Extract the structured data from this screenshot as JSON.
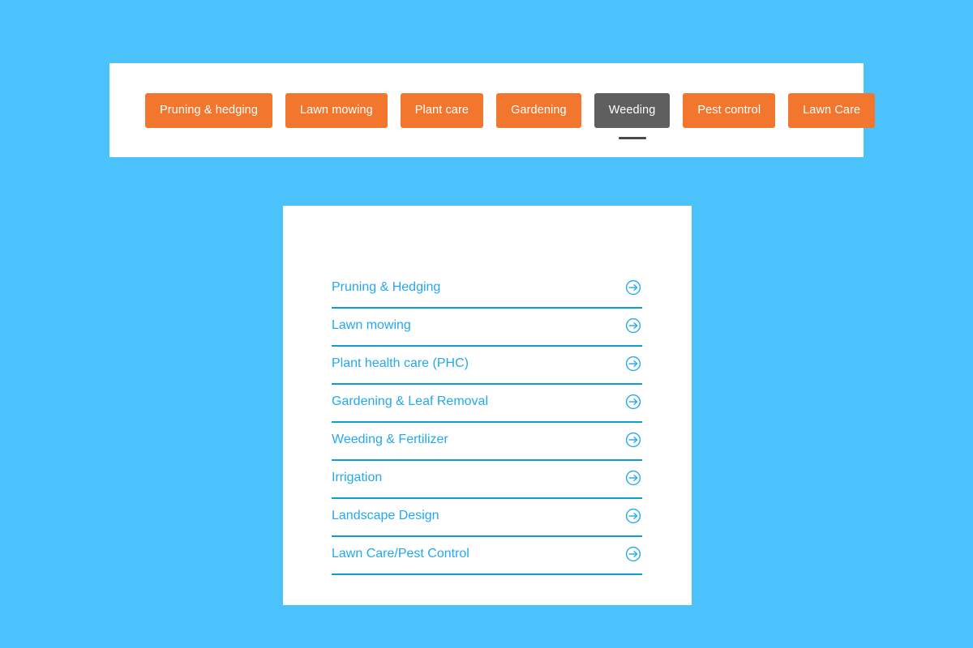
{
  "theme": {
    "page_background": "#4cc2fd",
    "card_background": "#ffffff",
    "tab_color": "#f2762e",
    "tab_active_color": "#5f5f5f",
    "tab_text_color": "#ffffff",
    "link_color": "#24a8f0",
    "divider_color": "#0d9ed9"
  },
  "tabbar": {
    "name": "service-category-tabs",
    "active_index": 4,
    "tabs": [
      {
        "label": "Pruning & hedging",
        "active": false
      },
      {
        "label": "Lawn mowing",
        "active": false
      },
      {
        "label": "Plant care",
        "active": false
      },
      {
        "label": "Gardening",
        "active": false
      },
      {
        "label": "Weeding",
        "active": true
      },
      {
        "label": "Pest control",
        "active": false
      },
      {
        "label": "Lawn Care",
        "active": false
      }
    ]
  },
  "services": {
    "name": "services-link-list",
    "arrow_icon": "arrow-circle-right-icon",
    "items": [
      {
        "label": "Pruning & Hedging"
      },
      {
        "label": "Lawn mowing"
      },
      {
        "label": "Plant health care (PHC)"
      },
      {
        "label": "Gardening & Leaf Removal"
      },
      {
        "label": "Weeding & Fertilizer"
      },
      {
        "label": "Irrigation"
      },
      {
        "label": "Landscape Design"
      },
      {
        "label": "Lawn Care/Pest Control"
      }
    ]
  }
}
